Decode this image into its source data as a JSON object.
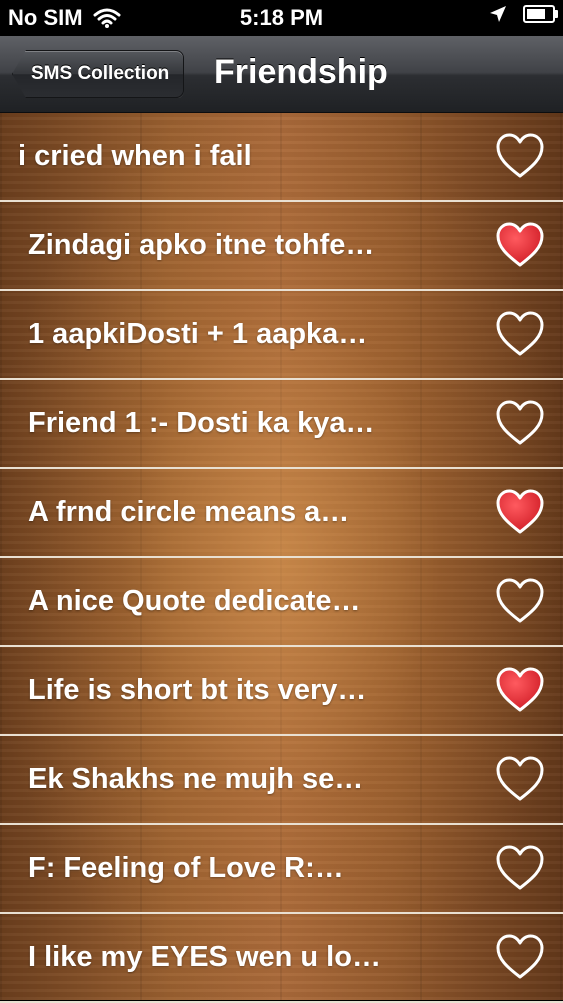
{
  "status_bar": {
    "carrier": "No SIM",
    "time": "5:18 PM",
    "icons": [
      "wifi-icon",
      "location-arrow-icon",
      "battery-icon"
    ]
  },
  "nav": {
    "back_label": "SMS Collection",
    "title": "Friendship"
  },
  "colors": {
    "heart_filled": "#d3212a",
    "heart_outline": "#ffffff",
    "divider": "#e9e0d2"
  },
  "items": [
    {
      "text": "i cried when i fail",
      "favorite": false
    },
    {
      "text": "Zindagi apko itne tohfe…",
      "favorite": true
    },
    {
      "text": "1 aapkiDosti + 1 aapka…",
      "favorite": false
    },
    {
      "text": "Friend 1 :- Dosti ka kya…",
      "favorite": false
    },
    {
      "text": "A frnd circle means a…",
      "favorite": true
    },
    {
      "text": "A nice Quote dedicate…",
      "favorite": false
    },
    {
      "text": "Life is short bt its very…",
      "favorite": true
    },
    {
      "text": "Ek Shakhs ne mujh se…",
      "favorite": false
    },
    {
      "text": "F: Feeling of Love R:…",
      "favorite": false
    },
    {
      "text": "I like my EYES wen u lo…",
      "favorite": false
    }
  ]
}
